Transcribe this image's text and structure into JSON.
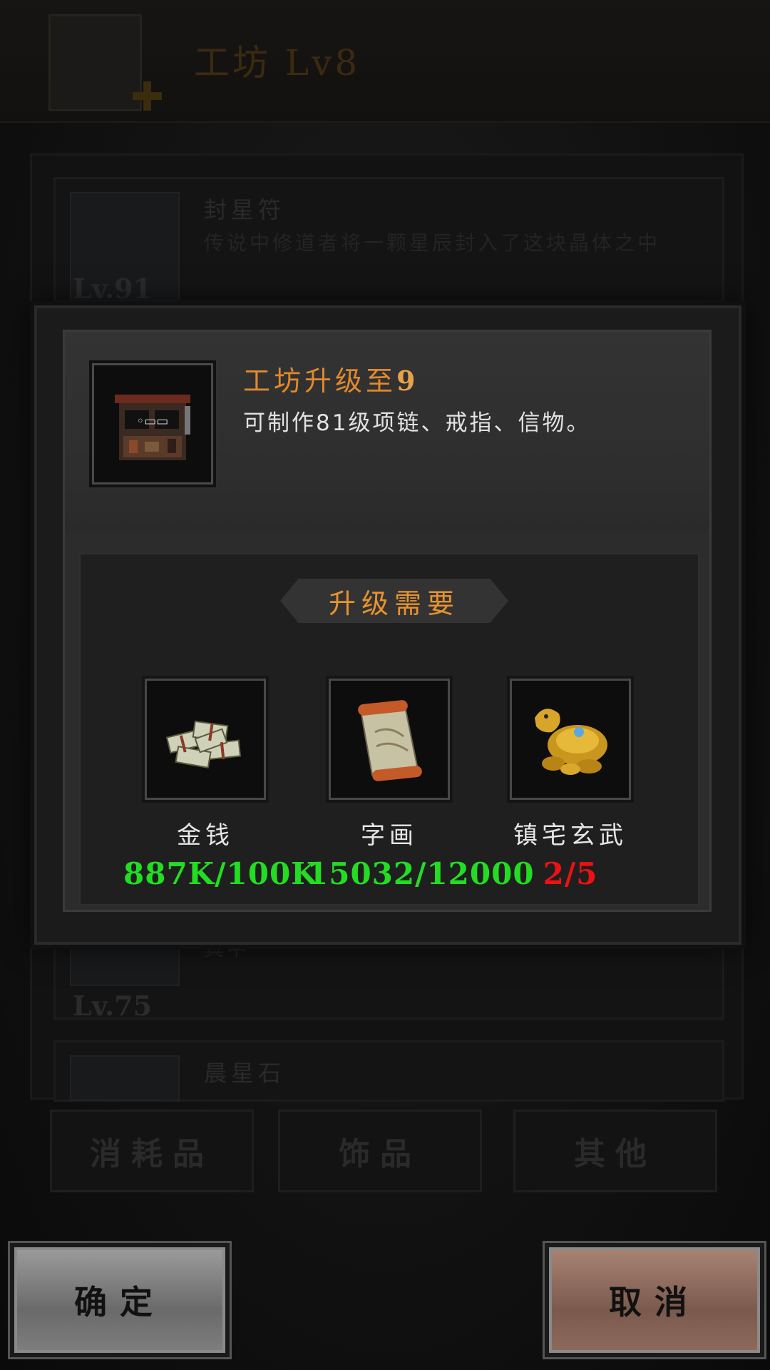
{
  "header": {
    "title": "工坊",
    "level": "Lv8"
  },
  "list": {
    "items": [
      {
        "name": "封星符",
        "desc": "传说中修道者将一颗星辰封入了这块晶体之中",
        "level": "Lv.91"
      },
      {
        "name": "",
        "desc": "其中",
        "level": "Lv.75"
      },
      {
        "name": "晨星石",
        "desc": "",
        "level": ""
      }
    ]
  },
  "tabs": [
    "消耗品",
    "饰品",
    "其他"
  ],
  "dialog": {
    "title": "工坊升级至",
    "target_level": "9",
    "description": "可制作81级项链、戒指、信物。",
    "requirements_label": "升级需要",
    "requirements": [
      {
        "name": "金钱",
        "count": "887K/100K",
        "status_color": "#22dd22",
        "icon": "money-stack-icon"
      },
      {
        "name": "字画",
        "count": "15032/12000",
        "status_color": "#22dd22",
        "icon": "scroll-icon"
      },
      {
        "name": "镇宅玄武",
        "count": "2/5",
        "status_color": "#ee1111",
        "icon": "golden-turtle-icon"
      }
    ]
  },
  "buttons": {
    "confirm": "确定",
    "cancel": "取消"
  }
}
